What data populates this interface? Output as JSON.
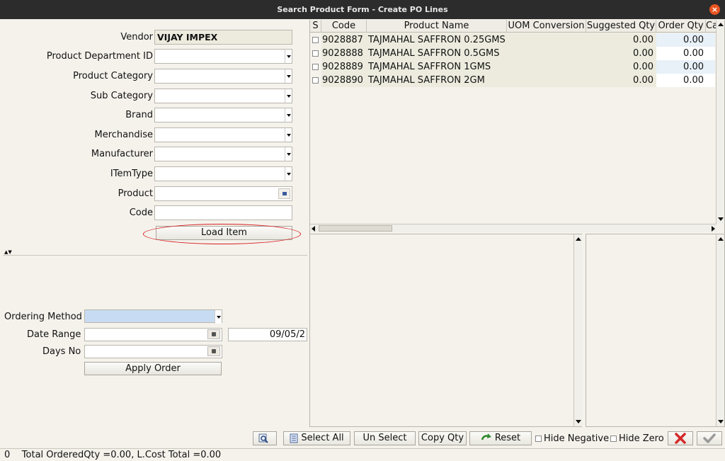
{
  "window": {
    "title": "Search Product Form - Create PO Lines",
    "close_glyph": "×"
  },
  "filter_form": {
    "vendor": {
      "label": "Vendor",
      "value": "VIJAY IMPEX"
    },
    "department": {
      "label": "Product Department ID"
    },
    "category": {
      "label": "Product Category"
    },
    "sub_category": {
      "label": "Sub Category"
    },
    "brand": {
      "label": "Brand"
    },
    "merchandise": {
      "label": "Merchandise"
    },
    "manufacturer": {
      "label": "Manufacturer"
    },
    "item_type": {
      "label": "ITemType"
    },
    "product": {
      "label": "Product"
    },
    "code": {
      "label": "Code"
    },
    "load_button": "Load Item"
  },
  "ordering": {
    "method_label": "Ordering Method",
    "date_range_label": "Date Range",
    "date_to_value": "09/05/2",
    "days_no_label": "Days No",
    "apply_button": "Apply Order"
  },
  "grid": {
    "columns": [
      "S",
      "Code",
      "Product Name",
      "UOM Conversion",
      "Suggested Qty",
      "Order Qty",
      "Ca"
    ],
    "rows": [
      {
        "code": "9028887",
        "name": "TAJMAHAL SAFFRON 0.25GMS",
        "uom": "",
        "suggested": "0.00",
        "order": "0.00"
      },
      {
        "code": "9028888",
        "name": "TAJMAHAL SAFFRON 0.5GMS",
        "uom": "",
        "suggested": "0.00",
        "order": "0.00"
      },
      {
        "code": "9028889",
        "name": "TAJMAHAL SAFFRON 1GMS",
        "uom": "",
        "suggested": "0.00",
        "order": "0.00"
      },
      {
        "code": "9028890",
        "name": "TAJMAHAL SAFFRON 2GM",
        "uom": "",
        "suggested": "0.00",
        "order": "0.00"
      }
    ]
  },
  "toolbar": {
    "select_all": "Select All",
    "unselect": "Un Select",
    "copy_qty": "Copy Qty",
    "reset": "Reset",
    "hide_negative": "Hide Negative",
    "hide_zero": "Hide Zero"
  },
  "status": {
    "text": "0    Total OrderedQty =0.00, L.Cost Total =0.00"
  },
  "colors": {
    "accent": "#e95420",
    "highlight_ellipse": "#d61f1f",
    "selection": "#c7dcf2"
  },
  "icons": [
    "close-icon",
    "search-icon",
    "select-all-icon",
    "reset-icon",
    "cancel-icon",
    "ok-check-icon"
  ]
}
